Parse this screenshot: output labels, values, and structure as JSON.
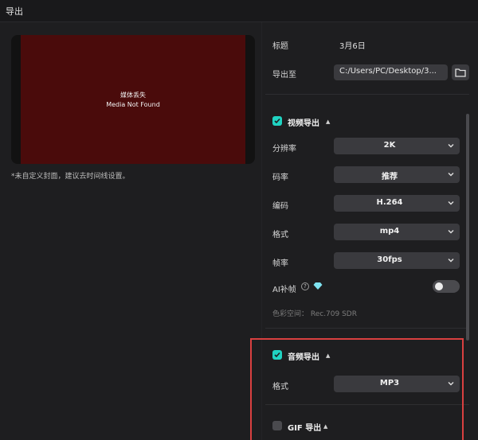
{
  "window": {
    "title": "导出"
  },
  "preview": {
    "missing_cn": "媒体丢失",
    "missing_en": "Media Not Found",
    "cover_note": "*未自定义封面，建议去时间线设置。"
  },
  "fields": {
    "title_label": "标题",
    "title_value": "3月6日",
    "export_to_label": "导出至",
    "export_path": "C:/Users/PC/Desktop/3..."
  },
  "video": {
    "checked": true,
    "title": "视频导出",
    "rows": [
      {
        "label": "分辨率",
        "value": "2K"
      },
      {
        "label": "码率",
        "value": "推荐"
      },
      {
        "label": "编码",
        "value": "H.264"
      },
      {
        "label": "格式",
        "value": "mp4"
      },
      {
        "label": "帧率",
        "value": "30fps"
      }
    ],
    "ai_label": "AI补帧",
    "ai_enabled": false,
    "color_space": "色彩空间： Rec.709 SDR"
  },
  "audio": {
    "checked": true,
    "title": "音频导出",
    "format_label": "格式",
    "format_value": "MP3"
  },
  "gif": {
    "checked": false,
    "title": "GIF 导出"
  },
  "colors": {
    "accent": "#20d3c2",
    "highlight": "#d94040",
    "media_bg": "#4a0b0b"
  }
}
